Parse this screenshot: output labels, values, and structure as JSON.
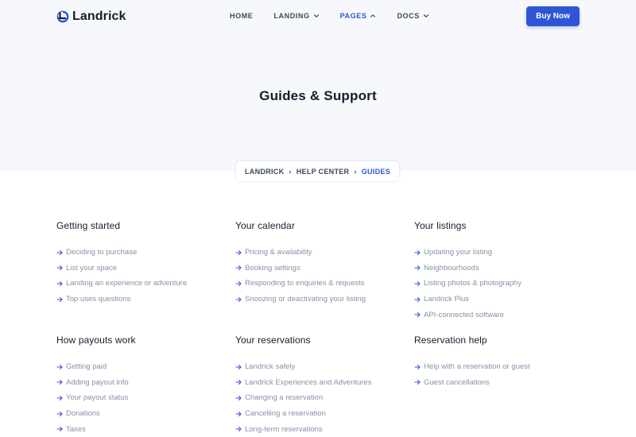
{
  "header": {
    "logo_text": "Landrick",
    "buy_label": "Buy Now",
    "nav": [
      {
        "label": "HOME",
        "dropdown": false,
        "active": false
      },
      {
        "label": "LANDING",
        "dropdown": true,
        "active": false
      },
      {
        "label": "PAGES",
        "dropdown": true,
        "active": true
      },
      {
        "label": "DOCS",
        "dropdown": true,
        "active": false
      }
    ]
  },
  "hero": {
    "title": "Guides & Support"
  },
  "breadcrumb": {
    "items": [
      "LANDRICK",
      "HELP CENTER",
      "GUIDES"
    ]
  },
  "sections": [
    {
      "title": "Getting started",
      "links": [
        "Deciding to purchase",
        "List your space",
        "Landing an experience or adventure",
        "Top uses questions"
      ]
    },
    {
      "title": "Your calendar",
      "links": [
        "Pricing & availability",
        "Booking settings",
        "Responding to enquiries & requests",
        "Snoozing or deactivating your listing"
      ]
    },
    {
      "title": "Your listings",
      "links": [
        "Updating your listing",
        "Neighbourhoods",
        "Listing photos & photography",
        "Landrick Plus",
        "API-connected software"
      ]
    },
    {
      "title": "How payouts work",
      "links": [
        "Getting paid",
        "Adding payout info",
        "Your payout status",
        "Donations",
        "Taxes"
      ]
    },
    {
      "title": "Your reservations",
      "links": [
        "Landrick safely",
        "Landrick Experiences and Adventures",
        "Changing a reservation",
        "Cancelling a reservation",
        "Long-term reservations"
      ]
    },
    {
      "title": "Reservation help",
      "links": [
        "Help with a reservation or guest",
        "Guest cancellations"
      ]
    }
  ],
  "colors": {
    "primary": "#2f55d4",
    "heading": "#161c2d",
    "muted": "#8492a6",
    "hero_bg": "#f7f8fc"
  }
}
